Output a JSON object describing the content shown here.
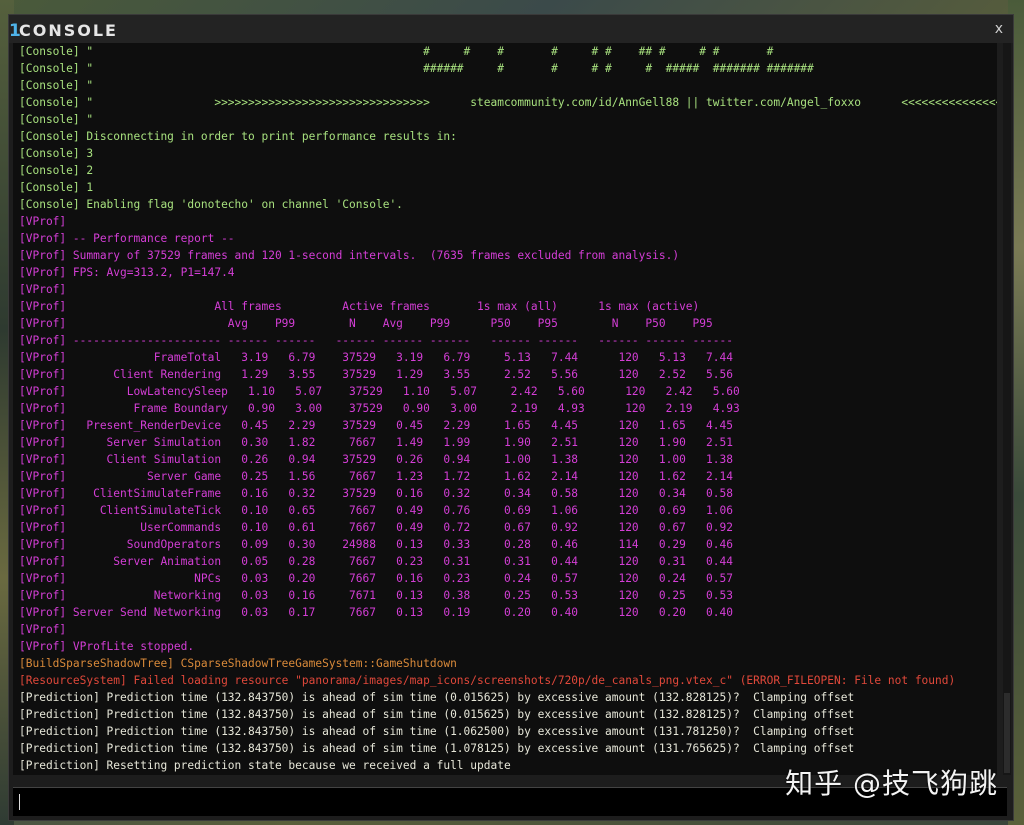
{
  "window": {
    "title_num": "1",
    "title": "CONSOLE",
    "close": "x"
  },
  "lines": [
    {
      "t": "c",
      "s": "[Console] \"                                                 #     #    #       #     # #    ## #     # #       #"
    },
    {
      "t": "c",
      "s": "[Console] \"                                                 ######     #       #     # #     #  #####  ####### #######"
    },
    {
      "t": "c",
      "s": "[Console] \""
    },
    {
      "t": "c",
      "s": "[Console] \"                  >>>>>>>>>>>>>>>>>>>>>>>>>>>>>>>>      steamcommunity.com/id/AnnGell88 || twitter.com/Angel_foxxo      <<<<<<<<<<<<<<<<<<<<<<<<<<<<<<<<<"
    },
    {
      "t": "c",
      "s": "[Console] \""
    },
    {
      "t": "c",
      "s": "[Console] Disconnecting in order to print performance results in:"
    },
    {
      "t": "c",
      "s": "[Console] 3"
    },
    {
      "t": "c",
      "s": "[Console] 2"
    },
    {
      "t": "c",
      "s": "[Console] 1"
    },
    {
      "t": "c",
      "s": "[Console] Enabling flag 'donotecho' on channel 'Console'."
    },
    {
      "t": "v",
      "s": "[VProf]"
    },
    {
      "t": "v",
      "s": "[VProf] -- Performance report --"
    },
    {
      "t": "v",
      "s": "[VProf] Summary of 37529 frames and 120 1-second intervals.  (7635 frames excluded from analysis.)"
    },
    {
      "t": "v",
      "s": "[VProf] FPS: Avg=313.2, P1=147.4"
    },
    {
      "t": "v",
      "s": "[VProf]"
    },
    {
      "t": "v",
      "s": "[VProf]                      All frames         Active frames       1s max (all)      1s max (active)"
    },
    {
      "t": "v",
      "s": "[VProf]                        Avg    P99        N    Avg    P99      P50    P95        N    P50    P95"
    },
    {
      "t": "v",
      "s": "[VProf] ---------------------- ------ ------   ------ ------ ------   ------ ------   ------ ------ ------"
    },
    {
      "t": "v",
      "s": "[VProf]             FrameTotal   3.19   6.79    37529   3.19   6.79     5.13   7.44      120   5.13   7.44"
    },
    {
      "t": "v",
      "s": "[VProf]       Client Rendering   1.29   3.55    37529   1.29   3.55     2.52   5.56      120   2.52   5.56"
    },
    {
      "t": "v",
      "s": "[VProf]         LowLatencySleep   1.10   5.07    37529   1.10   5.07     2.42   5.60      120   2.42   5.60"
    },
    {
      "t": "v",
      "s": "[VProf]          Frame Boundary   0.90   3.00    37529   0.90   3.00     2.19   4.93      120   2.19   4.93"
    },
    {
      "t": "v",
      "s": "[VProf]   Present_RenderDevice   0.45   2.29    37529   0.45   2.29     1.65   4.45      120   1.65   4.45"
    },
    {
      "t": "v",
      "s": "[VProf]      Server Simulation   0.30   1.82     7667   1.49   1.99     1.90   2.51      120   1.90   2.51"
    },
    {
      "t": "v",
      "s": "[VProf]      Client Simulation   0.26   0.94    37529   0.26   0.94     1.00   1.38      120   1.00   1.38"
    },
    {
      "t": "v",
      "s": "[VProf]            Server Game   0.25   1.56     7667   1.23   1.72     1.62   2.14      120   1.62   2.14"
    },
    {
      "t": "v",
      "s": "[VProf]    ClientSimulateFrame   0.16   0.32    37529   0.16   0.32     0.34   0.58      120   0.34   0.58"
    },
    {
      "t": "v",
      "s": "[VProf]     ClientSimulateTick   0.10   0.65     7667   0.49   0.76     0.69   1.06      120   0.69   1.06"
    },
    {
      "t": "v",
      "s": "[VProf]           UserCommands   0.10   0.61     7667   0.49   0.72     0.67   0.92      120   0.67   0.92"
    },
    {
      "t": "v",
      "s": "[VProf]         SoundOperators   0.09   0.30    24988   0.13   0.33     0.28   0.46      114   0.29   0.46"
    },
    {
      "t": "v",
      "s": "[VProf]       Server Animation   0.05   0.28     7667   0.23   0.31     0.31   0.44      120   0.31   0.44"
    },
    {
      "t": "v",
      "s": "[VProf]                   NPCs   0.03   0.20     7667   0.16   0.23     0.24   0.57      120   0.24   0.57"
    },
    {
      "t": "v",
      "s": "[VProf]             Networking   0.03   0.16     7671   0.13   0.38     0.25   0.53      120   0.25   0.53"
    },
    {
      "t": "v",
      "s": "[VProf] Server Send Networking   0.03   0.17     7667   0.13   0.19     0.20   0.40      120   0.20   0.40"
    },
    {
      "t": "v",
      "s": "[VProf]"
    },
    {
      "t": "v",
      "s": "[VProf] VProfLite stopped."
    },
    {
      "t": "b",
      "s": "[BuildSparseShadowTree] CSparseShadowTreeGameSystem::GameShutdown"
    },
    {
      "t": "r",
      "s": "[ResourceSystem] Failed loading resource \"panorama/images/map_icons/screenshots/720p/de_canals_png.vtex_c\" (ERROR_FILEOPEN: File not found)"
    },
    {
      "t": "p",
      "s": "[Prediction] Prediction time (132.843750) is ahead of sim time (0.015625) by excessive amount (132.828125)?  Clamping offset"
    },
    {
      "t": "p",
      "s": "[Prediction] Prediction time (132.843750) is ahead of sim time (0.015625) by excessive amount (132.828125)?  Clamping offset"
    },
    {
      "t": "p",
      "s": "[Prediction] Prediction time (132.843750) is ahead of sim time (1.062500) by excessive amount (131.781250)?  Clamping offset"
    },
    {
      "t": "p",
      "s": "[Prediction] Prediction time (132.843750) is ahead of sim time (1.078125) by excessive amount (131.765625)?  Clamping offset"
    },
    {
      "t": "p",
      "s": "[Prediction] Resetting prediction state because we received a full update"
    }
  ],
  "input": {
    "value": ""
  },
  "watermark": "知乎 @技飞狗跳"
}
